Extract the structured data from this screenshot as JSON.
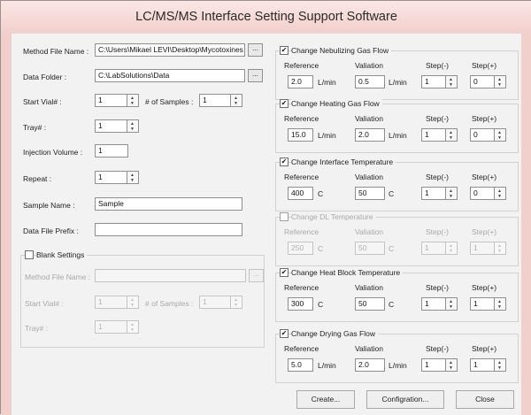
{
  "window": {
    "title": "LC/MS/MS Interface Setting Support Software"
  },
  "left": {
    "method_file": {
      "label": "Method File Name :",
      "value": "C:\\Users\\Mikael LEVI\\Desktop\\Mycotoxines",
      "browse": "..."
    },
    "data_folder": {
      "label": "Data Folder :",
      "value": "C:\\LabSolutions\\Data",
      "browse": "..."
    },
    "start_vial": {
      "label": "Start Vial# :",
      "value": "1"
    },
    "num_samples": {
      "label": "# of Samples :",
      "value": "1"
    },
    "tray": {
      "label": "Tray# :",
      "value": "1"
    },
    "injection_volume": {
      "label": "Injection Volume :",
      "value": "1"
    },
    "repeat": {
      "label": "Repeat :",
      "value": "1"
    },
    "sample_name": {
      "label": "Sample Name :",
      "value": "Sample"
    },
    "data_file_prefix": {
      "label": "Data File Prefix :",
      "value": ""
    },
    "blank": {
      "title": "Blank Settings",
      "checked": false,
      "method_file": {
        "label": "Method File Name :",
        "value": "",
        "browse": "..."
      },
      "start_vial": {
        "label": "Start Vial# :",
        "value": "1"
      },
      "num_samples": {
        "label": "# of Samples :",
        "value": "1"
      },
      "tray": {
        "label": "Tray# :",
        "value": "1"
      }
    }
  },
  "groups": [
    {
      "title": "Change Nebulizing Gas Flow",
      "checked": true,
      "enabled": true,
      "reference_label": "Reference",
      "valiation_label": "Valiation",
      "step_minus_label": "Step(-)",
      "step_plus_label": "Step(+)",
      "reference": "2.0",
      "reference_unit": "L/min",
      "valiation": "0.5",
      "valiation_unit": "L/min",
      "step_minus": "1",
      "step_plus": "0"
    },
    {
      "title": "Change Heating Gas Flow",
      "checked": true,
      "enabled": true,
      "reference_label": "Reference",
      "valiation_label": "Valiation",
      "step_minus_label": "Step(-)",
      "step_plus_label": "Step(+)",
      "reference": "15.0",
      "reference_unit": "L/min",
      "valiation": "2.0",
      "valiation_unit": "L/min",
      "step_minus": "1",
      "step_plus": "0"
    },
    {
      "title": "Change Interface Temperature",
      "checked": true,
      "enabled": true,
      "reference_label": "Reference",
      "valiation_label": "Valiation",
      "step_minus_label": "Step(-)",
      "step_plus_label": "Step(+)",
      "reference": "400",
      "reference_unit": "C",
      "valiation": "50",
      "valiation_unit": "C",
      "step_minus": "1",
      "step_plus": "0"
    },
    {
      "title": "Change DL Temperature",
      "checked": false,
      "enabled": false,
      "reference_label": "Reference",
      "valiation_label": "Valiation",
      "step_minus_label": "Step(-)",
      "step_plus_label": "Step(+)",
      "reference": "250",
      "reference_unit": "C",
      "valiation": "50",
      "valiation_unit": "C",
      "step_minus": "1",
      "step_plus": "1"
    },
    {
      "title": "Change Heat Block Temperature",
      "checked": true,
      "enabled": true,
      "reference_label": "Reference",
      "valiation_label": "Valiation",
      "step_minus_label": "Step(-)",
      "step_plus_label": "Step(+)",
      "reference": "300",
      "reference_unit": "C",
      "valiation": "50",
      "valiation_unit": "C",
      "step_minus": "1",
      "step_plus": "1"
    },
    {
      "title": "Change Drying Gas Flow",
      "checked": true,
      "enabled": true,
      "reference_label": "Reference",
      "valiation_label": "Valiation",
      "step_minus_label": "Step(-)",
      "step_plus_label": "Step(+)",
      "reference": "5.0",
      "reference_unit": "L/min",
      "valiation": "2.0",
      "valiation_unit": "L/min",
      "step_minus": "1",
      "step_plus": "1"
    }
  ],
  "buttons": {
    "create": "Create...",
    "configuration": "Configration...",
    "close": "Close"
  },
  "icons": {
    "checkbox_checked": "check-mark",
    "spin_up": "up-arrow",
    "spin_down": "down-arrow",
    "browse": "ellipsis"
  }
}
